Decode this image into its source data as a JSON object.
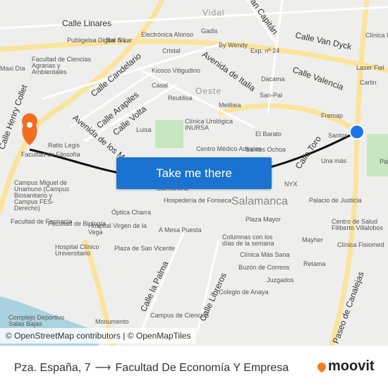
{
  "map": {
    "streets": [
      "Calle Linares",
      "Calle Van Dyck",
      "Avenida de Italia",
      "Calle Valencia",
      "Calle Candelario",
      "Calle Arapiles",
      "Calle Volta",
      "Avenida de los Maristas",
      "Calle Toro",
      "Calle la Palma",
      "Calle Libreros",
      "Paseo de Canalejas",
      "Calle Henry Collet",
      "Gran Capitán"
    ],
    "districts": [
      "Vidal",
      "Oeste"
    ],
    "city": "Salamanca",
    "pois": [
      "Electrónica Alonso",
      "Gadis",
      "Bar Nikar",
      "Publigelsa Digital S.L.",
      "Cristal",
      "By Wendy",
      "Exp. nº 24",
      "Facultad de Ciencias Agrarias y Ambientales",
      "Maxi Día",
      "Kiosco Vitigudino",
      "Dacama",
      "Casal",
      "Reutilisa",
      "San-Pal",
      "Melibea",
      "Clínica Urológica INURSA",
      "Fremap",
      "Santos",
      "El Barato",
      "Santos Ochoa",
      "Centro Médico Adeslas",
      "Ratio Legis",
      "Facultad de Filosofía",
      "Luisa",
      "Campus Miguel de Unamuno (Campus Biosanitario y Campus FES-Derecho)",
      "Óptica Charra",
      "Hospedería de Fonseca",
      "Salmantina",
      "Facultad de Farmacia",
      "Facultad de Biología",
      "Hospital Virgen de la Vega",
      "Hospital Clínico Universitario",
      "A Mesa Puesta",
      "Plaza de San Vicente",
      "Plaza Mayor",
      "Columnas con los días de la semana",
      "Clínica Más Sana",
      "Buzón de Correos",
      "Juzgados",
      "Colegio de Anaya",
      "NYX",
      "Palacio de Justicia",
      "Una más",
      "Pabellón La Alamedilla",
      "Centro de Salud Filiberto Villalobos",
      "Clínica Fisiomed",
      "Mayher",
      "Retama",
      "Campus de Ciencias",
      "Monumento",
      "Complejo Deportivo Salas Bajas",
      "Laser Fiel",
      "Carlin",
      "Clínica Miguel"
    ]
  },
  "cta_label": "Take me there",
  "attribution": "© OpenStreetMap contributors | © OpenMapTiles",
  "route": {
    "origin": "Pza. España, 7",
    "arrow": "⟶",
    "destination": "Facultad De Economía Y Empresa"
  },
  "brand": "moovit",
  "colors": {
    "accent": "#1a73d1",
    "origin_marker": "#1a73e8",
    "destination_marker": "#f26d21",
    "route_line": "#111111",
    "brand": "#f47b20",
    "water": "#aad3df",
    "park": "#c8e6c0",
    "major_road": "#fbe39b"
  }
}
